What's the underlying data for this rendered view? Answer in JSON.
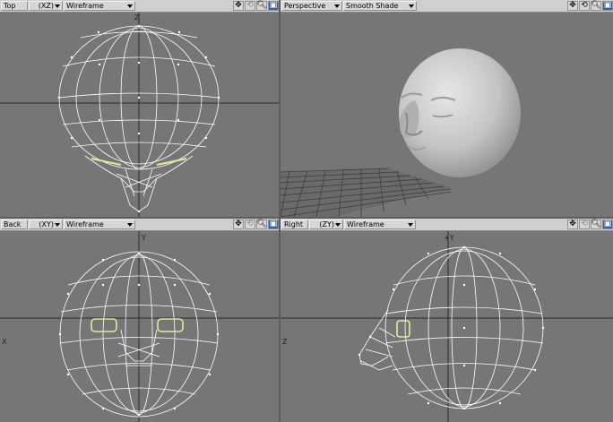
{
  "viewports": {
    "top": {
      "name": "Top",
      "axis": "(XZ)",
      "mode": "Wireframe"
    },
    "persp": {
      "name": "Perspective",
      "mode": "Smooth Shade"
    },
    "back": {
      "name": "Back",
      "axis": "(XY)",
      "mode": "Wireframe"
    },
    "right": {
      "name": "Right",
      "axis": "(ZY)",
      "mode": "Wireframe"
    }
  },
  "axis_labels": {
    "top_z": "Z",
    "back_y": "Y",
    "back_x": "X",
    "right_y": "+Y",
    "right_z": "Z"
  },
  "icons": [
    "move-view-icon",
    "rotate-view-icon",
    "zoom-icon",
    "maximize-view-icon"
  ],
  "colors": {
    "viewport_bg": "#767676",
    "wire": "#ffffff",
    "selected": "#e8e89a",
    "header_bg": "#cfcfcf"
  }
}
